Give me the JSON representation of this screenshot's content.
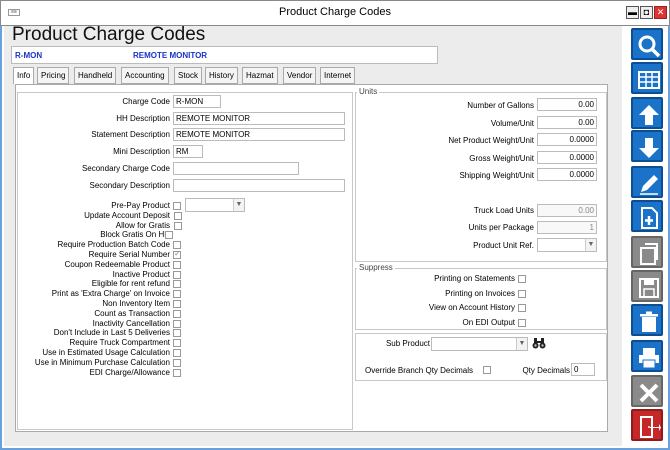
{
  "window": {
    "title": "Product Charge Codes",
    "min": "▬",
    "max": "◘",
    "close": "✕",
    "app_icon_text": "≡≡"
  },
  "page_title": "Product Charge Codes",
  "record": {
    "code": "R-MON",
    "description": "REMOTE MONITOR"
  },
  "tabs": [
    "Info",
    "Pricing",
    "Handheld",
    "Accounting",
    "Stock",
    "History",
    "Hazmat",
    "Vendor",
    "Internet"
  ],
  "left": {
    "charge_code": {
      "label": "Charge Code",
      "value": "R-MON"
    },
    "hh_description": {
      "label": "HH Description",
      "value": "REMOTE MONITOR"
    },
    "statement_description": {
      "label": "Statement Description",
      "value": "REMOTE MONITOR"
    },
    "mini_description": {
      "label": "Mini Description",
      "value": "RM"
    },
    "secondary_charge_code": {
      "label": "Secondary Charge Code",
      "value": ""
    },
    "secondary_description": {
      "label": "Secondary Description",
      "value": ""
    },
    "checkboxes": [
      {
        "label": "Pre-Pay Product",
        "checked": false
      },
      {
        "label": "Update Account Deposit",
        "checked": false
      },
      {
        "label": "Allow for Gratis",
        "checked": false
      },
      {
        "label": "Block Gratis On HH",
        "checked": false
      },
      {
        "label": "Require Production Batch Code",
        "checked": false
      },
      {
        "label": "Require Serial Number",
        "checked": true
      },
      {
        "label": "Coupon Redeemable Product",
        "checked": false
      },
      {
        "label": "Inactive Product",
        "checked": false
      },
      {
        "label": "Eligible for rent refund",
        "checked": false
      },
      {
        "label": "Print as 'Extra Charge' on Invoice",
        "checked": false
      },
      {
        "label": "Non Inventory Item",
        "checked": false
      },
      {
        "label": "Count as Transaction",
        "checked": false
      },
      {
        "label": "Inactivity Cancellation",
        "checked": false
      },
      {
        "label": "Don't Include in Last 5 Deliveries",
        "checked": false
      },
      {
        "label": "Require Truck Compartment",
        "checked": false
      },
      {
        "label": "Use in Estimated Usage Calculation",
        "checked": false
      },
      {
        "label": "Use in Minimum Purchase Calculation",
        "checked": false
      },
      {
        "label": "EDI Charge/Allowance",
        "checked": false
      }
    ]
  },
  "units": {
    "title": "Units",
    "fields": [
      {
        "label": "Number of Gallons",
        "value": "0.00"
      },
      {
        "label": "Volume/Unit",
        "value": "0.00"
      },
      {
        "label": "Net Product Weight/Unit",
        "value": "0.0000"
      },
      {
        "label": "Gross Weight/Unit",
        "value": "0.0000"
      },
      {
        "label": "Shipping Weight/Unit",
        "value": "0.0000"
      }
    ],
    "truck_load_units": {
      "label": "Truck Load Units",
      "value": "0.00"
    },
    "units_per_package": {
      "label": "Units per Package",
      "value": "1"
    },
    "product_unit_ref": {
      "label": "Product Unit Ref.",
      "value": ""
    }
  },
  "suppress": {
    "title": "Suppress",
    "items": [
      {
        "label": "Printing on Statements",
        "checked": false
      },
      {
        "label": "Printing on Invoices",
        "checked": false
      },
      {
        "label": "View on Account History",
        "checked": false
      },
      {
        "label": "On EDI Output",
        "checked": false
      }
    ]
  },
  "sub": {
    "sub_product_label": "Sub Product",
    "sub_product_value": "",
    "override_label": "Override Branch Qty Decimals",
    "qty_decimals_label": "Qty Decimals",
    "qty_decimals_value": "0"
  },
  "toolbar": [
    {
      "name": "search-icon",
      "color": "#1a73c8"
    },
    {
      "name": "grid-icon",
      "color": "#1a73c8"
    },
    {
      "name": "arrow-up-icon",
      "color": "#1a73c8"
    },
    {
      "name": "arrow-down-icon",
      "color": "#1a73c8"
    },
    {
      "name": "edit-pencil-icon",
      "color": "#1a73c8"
    },
    {
      "name": "new-document-icon",
      "color": "#1a73c8"
    },
    {
      "name": "copy-document-icon",
      "color": "#8a8a8a"
    },
    {
      "name": "save-disk-icon",
      "color": "#8a8a8a"
    },
    {
      "name": "trash-icon",
      "color": "#1a73c8"
    },
    {
      "name": "print-icon",
      "color": "#1a73c8"
    },
    {
      "name": "close-x-icon",
      "color": "#8a8a8a"
    },
    {
      "name": "exit-door-icon",
      "color": "#c62828"
    }
  ]
}
